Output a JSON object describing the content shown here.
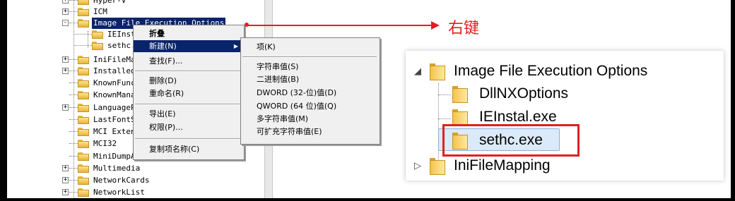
{
  "tree": {
    "rows": [
      {
        "label": "Hyper-V",
        "expander": "+"
      },
      {
        "label": "ICM",
        "expander": "+"
      },
      {
        "label": "Image File Execution Options",
        "expander": "-"
      },
      {
        "label": "IEInstal.exe",
        "expander": ""
      },
      {
        "label": "sethc.exe",
        "expander": ""
      },
      {
        "label": "IniFileMapping",
        "expander": "+"
      },
      {
        "label": "InstalledFeatures",
        "expander": "+"
      },
      {
        "label": "KnownFunctionTableDlls",
        "expander": ""
      },
      {
        "label": "KnownManagedDebuggingDlls",
        "expander": ""
      },
      {
        "label": "LanguagePack",
        "expander": "+"
      },
      {
        "label": "LastFontSweep",
        "expander": ""
      },
      {
        "label": "MCI Extensions",
        "expander": ""
      },
      {
        "label": "MCI32",
        "expander": ""
      },
      {
        "label": "MiniDumpAuxiliaryDlls",
        "expander": ""
      },
      {
        "label": "Multimedia",
        "expander": "+"
      },
      {
        "label": "NetworkCards",
        "expander": "+"
      },
      {
        "label": "NetworkList",
        "expander": "+"
      }
    ]
  },
  "context_menu": {
    "items": [
      "折叠",
      "新建(N)",
      "查找(F)...",
      "删除(D)",
      "重命名(R)",
      "导出(E)",
      "权限(P)...",
      "复制项名称(C)"
    ]
  },
  "new_submenu": {
    "items": [
      "项(K)",
      "字符串值(S)",
      "二进制值(B)",
      "DWORD (32-位)值(D)",
      "QWORD (64 位)值(Q)",
      "多字符串值(M)",
      "可扩充字符串值(E)"
    ]
  },
  "annotation": {
    "label": "右键",
    "color": "#e02020"
  },
  "inset": {
    "rows": [
      "Image File Execution Options",
      "DllNXOptions",
      "IEInstal.exe",
      "sethc.exe",
      "IniFileMapping"
    ],
    "expanded_glyph": "◢",
    "collapsed_glyph": "▷"
  },
  "icons": {
    "folder": "folder-icon",
    "submenu": "submenu-arrow-icon"
  }
}
